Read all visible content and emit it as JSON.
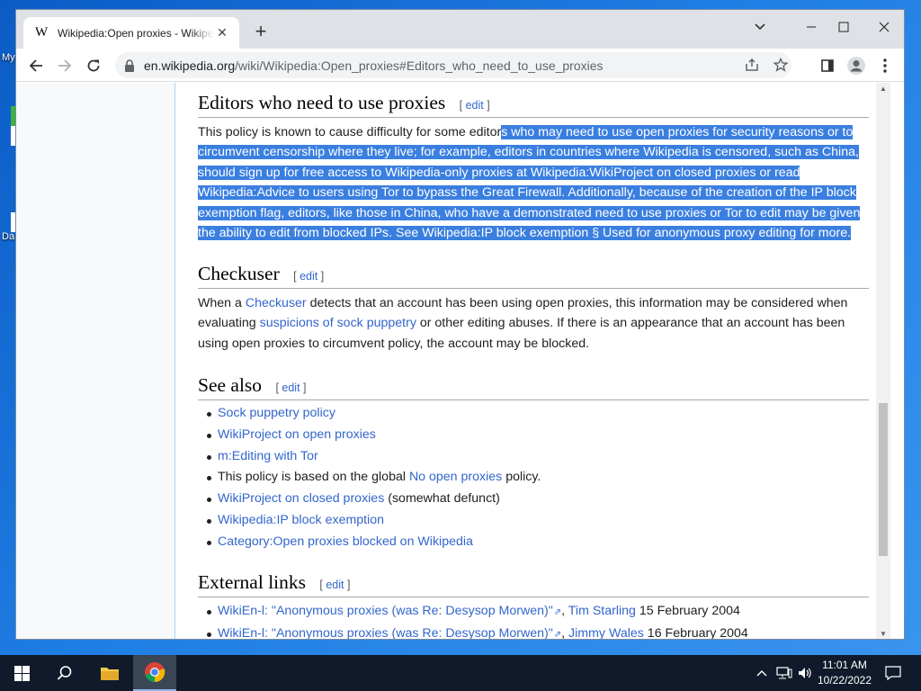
{
  "desktop": {
    "labels": [
      "My",
      "Da"
    ]
  },
  "browser": {
    "tab_title": "Wikipedia:Open proxies - Wikipedia",
    "tab_favicon": "W",
    "new_tab_label": "+",
    "url_host": "en.wikipedia.org",
    "url_path": "/wiki/Wikipedia:Open_proxies#Editors_who_need_to_use_proxies",
    "icons": [
      "back-arrow-icon",
      "forward-arrow-icon",
      "reload-icon",
      "lock-icon",
      "share-icon",
      "star-icon",
      "side-panel-icon",
      "profile-icon",
      "kebab-menu-icon"
    ]
  },
  "article": {
    "edit_label": "edit",
    "sections": {
      "editors": {
        "heading": "Editors who need to use proxies",
        "text_unselected": "This policy is known to cause difficulty for some editor",
        "text_selected": "s who may need to use open proxies for security reasons or to circumvent censorship where they live; for example, editors in countries where Wikipedia is censored, such as China, should sign up for free access to Wikipedia-only proxies at Wikipedia:WikiProject on closed proxies or read Wikipedia:Advice to users using Tor to bypass the Great Firewall. Additionally, because of the creation of the IP block exemption flag, editors, like those in China, who have a demonstrated need to use proxies or Tor to edit may be given the ability to edit from blocked IPs. See Wikipedia:IP block exemption § Used for anonymous proxy editing for more."
      },
      "checkuser": {
        "heading": "Checkuser",
        "t1": "When a ",
        "link1": "Checkuser",
        "t2": " detects that an account has been using open proxies, this information may be considered when evaluating ",
        "link2": "suspicions of sock puppetry",
        "t3": " or other editing abuses. If there is an appearance that an account has been using open proxies to circumvent policy, the account may be blocked."
      },
      "see_also": {
        "heading": "See also",
        "items": [
          {
            "link": "Sock puppetry policy"
          },
          {
            "link": "WikiProject on open proxies"
          },
          {
            "link": "m:Editing with Tor"
          },
          {
            "before": "This policy is based on the global ",
            "link": "No open proxies",
            "after": " policy."
          },
          {
            "link": "WikiProject on closed proxies",
            "after": " (somewhat defunct)"
          },
          {
            "link": "Wikipedia:IP block exemption"
          },
          {
            "link": "Category:Open proxies blocked on Wikipedia"
          }
        ]
      },
      "external_links": {
        "heading": "External links",
        "items": [
          {
            "link": "WikiEn-l: \"Anonymous proxies (was Re: Desysop Morwen)\"",
            "sep": ", ",
            "author": "Tim Starling",
            "date": " 15 February 2004"
          },
          {
            "link": "WikiEn-l: \"Anonymous proxies (was Re: Desysop Morwen)\"",
            "sep": ", ",
            "author": "Jimmy Wales",
            "date": " 16 February 2004"
          }
        ]
      }
    }
  },
  "taskbar": {
    "time": "11:01 AM",
    "date": "10/22/2022",
    "icons": [
      "start-icon",
      "search-icon",
      "file-explorer-icon",
      "chrome-icon",
      "tray-chevron-icon",
      "network-icon",
      "volume-icon",
      "notification-icon"
    ]
  }
}
